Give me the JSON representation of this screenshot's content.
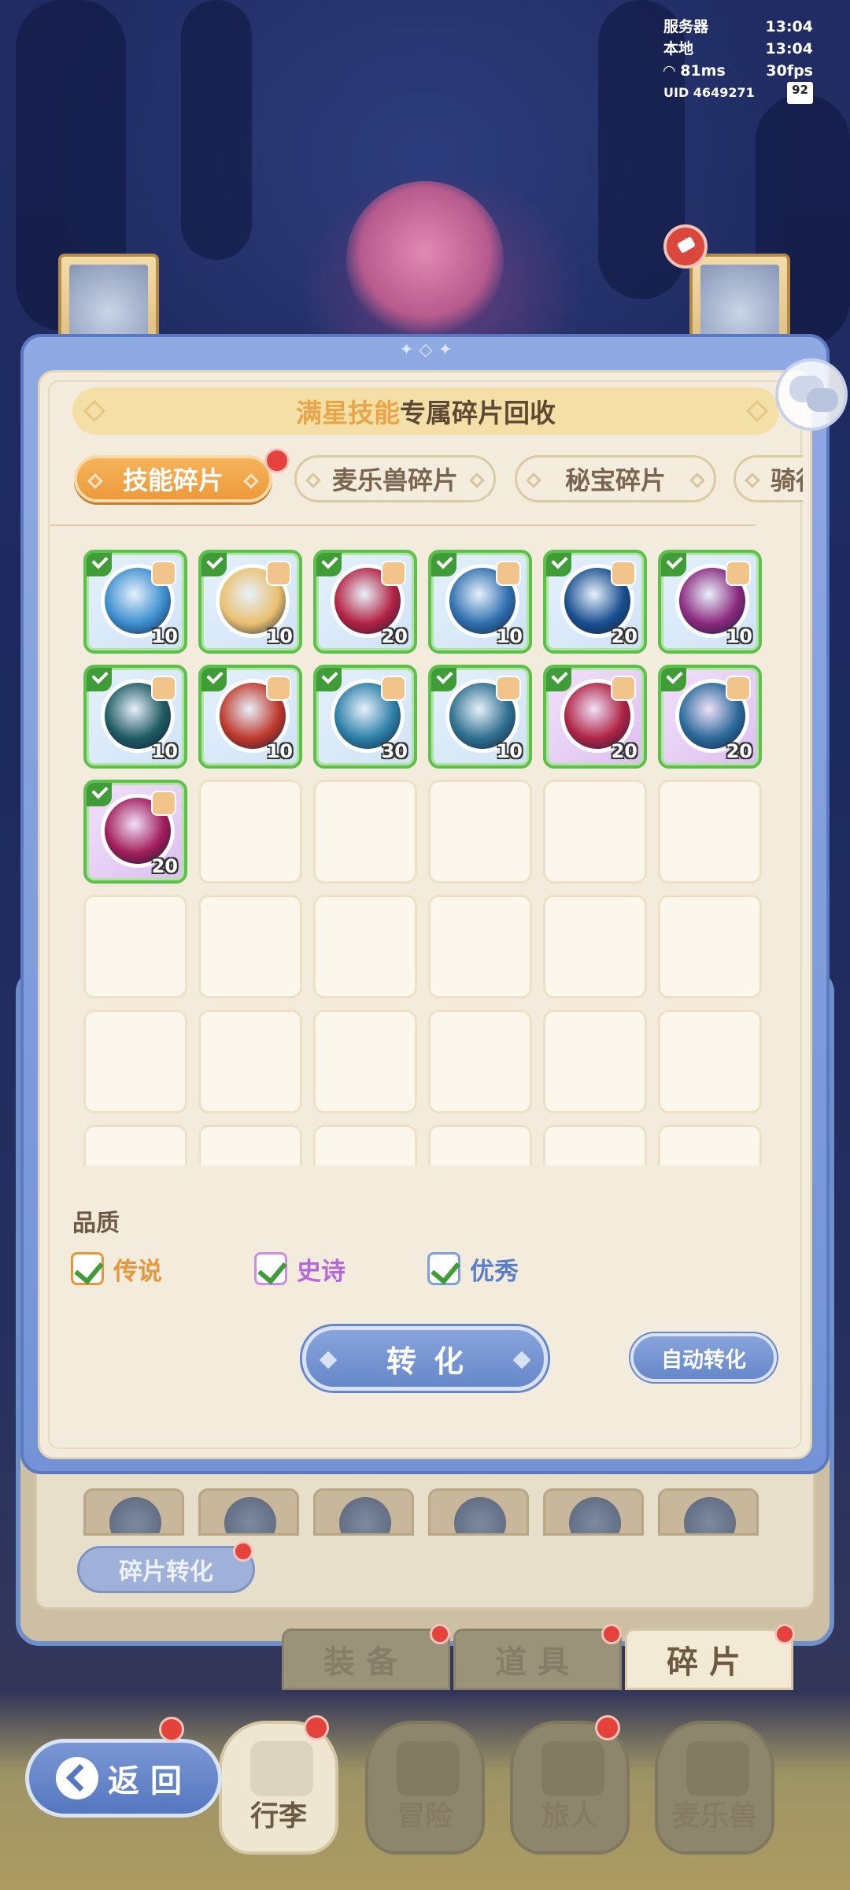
{
  "hud": {
    "server_label": "服务器",
    "server_time": "13:04",
    "local_label": "本地",
    "local_time": "13:04",
    "ping": "81ms",
    "fps": "30fps",
    "uid": "UID 4649271",
    "battery": "92"
  },
  "modal": {
    "title_highlight": "满星技能",
    "title_rest": "专属碎片回收",
    "tabs": [
      {
        "label": "技能碎片",
        "active": true
      },
      {
        "label": "麦乐兽碎片",
        "active": false
      },
      {
        "label": "秘宝碎片",
        "active": false
      },
      {
        "label": "骑行",
        "active": false
      }
    ],
    "items": [
      {
        "count": "10",
        "rarity": "rare",
        "orb": "#3d8fd0",
        "selected": true
      },
      {
        "count": "10",
        "rarity": "rare",
        "orb": "#e9c070",
        "selected": true
      },
      {
        "count": "20",
        "rarity": "rare",
        "orb": "#b32243",
        "selected": true
      },
      {
        "count": "10",
        "rarity": "rare",
        "orb": "#2f6fae",
        "selected": true
      },
      {
        "count": "20",
        "rarity": "rare",
        "orb": "#1a4f8f",
        "selected": true
      },
      {
        "count": "10",
        "rarity": "rare",
        "orb": "#8b2a7e",
        "selected": true
      },
      {
        "count": "10",
        "rarity": "rare",
        "orb": "#1f5a63",
        "selected": true
      },
      {
        "count": "10",
        "rarity": "rare",
        "orb": "#c0392b",
        "selected": true
      },
      {
        "count": "30",
        "rarity": "rare",
        "orb": "#2c7fa8",
        "selected": true
      },
      {
        "count": "10",
        "rarity": "rare",
        "orb": "#2f6f8f",
        "selected": true
      },
      {
        "count": "20",
        "rarity": "epic",
        "orb": "#b02446",
        "selected": true
      },
      {
        "count": "20",
        "rarity": "epic",
        "orb": "#2b6a9a",
        "selected": true
      },
      {
        "count": "20",
        "rarity": "epic",
        "orb": "#a11d5a",
        "selected": true
      }
    ],
    "quality_label": "品质",
    "quality_options": [
      {
        "label": "传说",
        "color": "#e8963a",
        "checked": true
      },
      {
        "label": "史诗",
        "color": "#b766d8",
        "checked": true
      },
      {
        "label": "优秀",
        "color": "#5a7fc8",
        "checked": true
      }
    ],
    "convert_label": "转化",
    "auto_convert_label": "自动转化"
  },
  "background": {
    "fragment_convert_label": "碎片转化",
    "inventory_tabs": [
      {
        "label": "装备",
        "active": false
      },
      {
        "label": "道具",
        "active": false
      },
      {
        "label": "碎片",
        "active": true
      }
    ],
    "nav": [
      {
        "label": "行李",
        "active": true
      },
      {
        "label": "冒险",
        "active": false
      },
      {
        "label": "旅人",
        "active": false
      },
      {
        "label": "麦乐兽",
        "active": false
      }
    ],
    "back_label": "返回"
  }
}
